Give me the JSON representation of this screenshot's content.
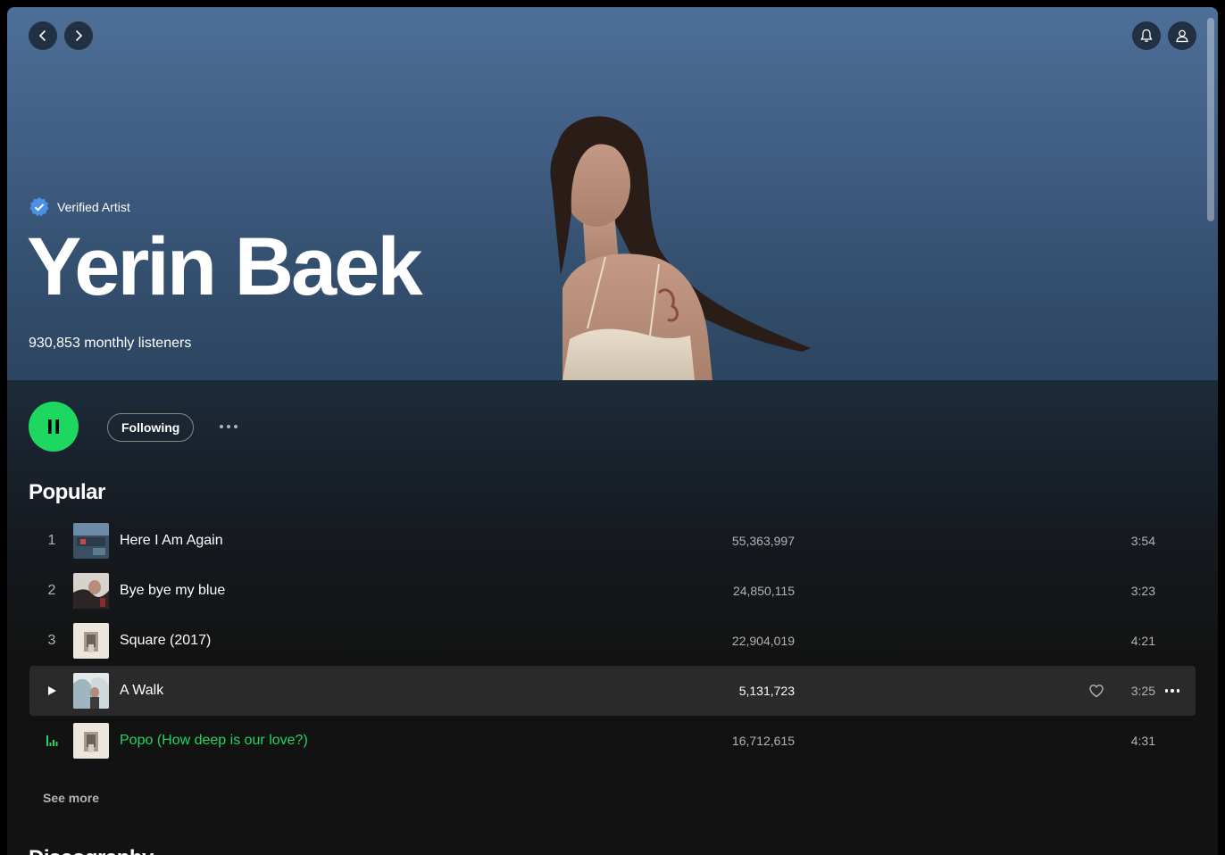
{
  "artist": {
    "verified_label": "Verified Artist",
    "name": "Yerin Baek",
    "listeners": "930,853 monthly listeners"
  },
  "icons": {
    "back": "chevron-left-icon",
    "forward": "chevron-right-icon",
    "notifications": "bell-icon",
    "profile": "user-icon",
    "verified": "verified-badge-icon",
    "play_state": "pause-icon"
  },
  "actions": {
    "follow_label": "Following"
  },
  "popular": {
    "title": "Popular",
    "see_more": "See more",
    "tracks": [
      {
        "num": "1",
        "title": "Here I Am Again",
        "plays": "55,363,997",
        "duration": "3:54"
      },
      {
        "num": "2",
        "title": "Bye bye my blue",
        "plays": "24,850,115",
        "duration": "3:23"
      },
      {
        "num": "3",
        "title": "Square (2017)",
        "plays": "22,904,019",
        "duration": "4:21"
      },
      {
        "num": "",
        "title": "A Walk",
        "plays": "5,131,723",
        "duration": "3:25",
        "state": "hover"
      },
      {
        "num": "",
        "title": "Popo (How deep is our love?)",
        "plays": "16,712,615",
        "duration": "4:31",
        "state": "playing"
      }
    ]
  },
  "discography": {
    "title": "Discography"
  },
  "colors": {
    "accent": "#1ed760",
    "background": "#121212",
    "hover_row": "#2a2a2a",
    "hero": "#4d6f98",
    "verified_blue": "#4c8fe8"
  }
}
